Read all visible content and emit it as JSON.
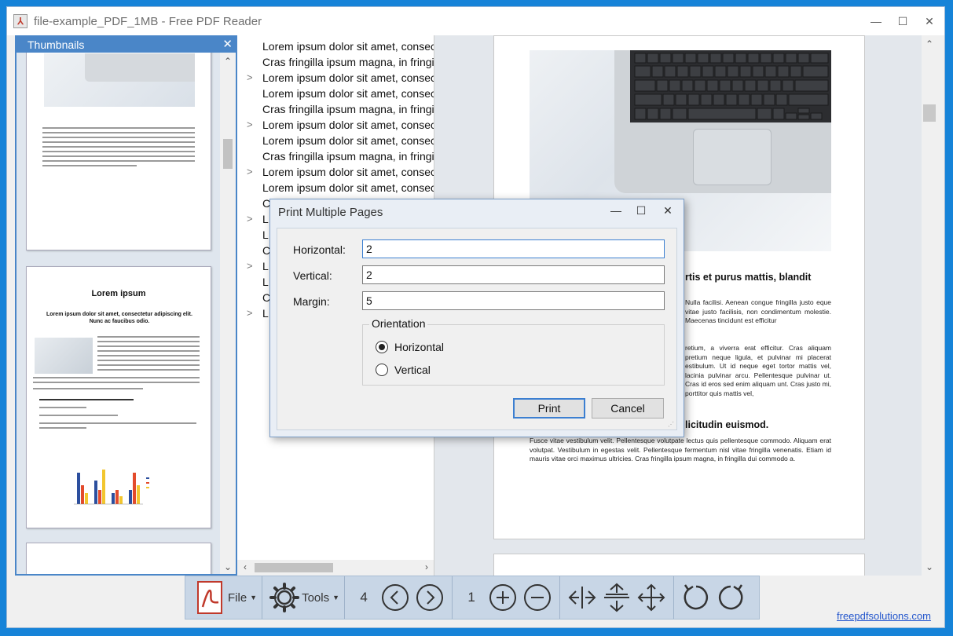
{
  "window": {
    "title": "file-example_PDF_1MB - Free PDF Reader",
    "minimize_glyph": "—",
    "maximize_glyph": "☐",
    "close_glyph": "✕"
  },
  "thumbnails": {
    "header": "Thumbnails",
    "close_glyph": "✕",
    "page2_title": "Lorem ipsum",
    "page2_subtitle": "Lorem ipsum dolor sit amet, consectetur adipiscing elit. Nunc ac faucibus odio."
  },
  "bookmarks": {
    "rows": [
      {
        "text": "Lorem ipsum dolor sit amet, consecte",
        "chevron": ""
      },
      {
        "text": "Cras fringilla ipsum magna, in fringilla",
        "chevron": ""
      },
      {
        "text": "Lorem ipsum dolor sit amet, consecte",
        "chevron": ">"
      },
      {
        "text": "Lorem ipsum dolor sit amet, consecte",
        "chevron": ""
      },
      {
        "text": "Cras fringilla ipsum magna, in fringilla",
        "chevron": ""
      },
      {
        "text": "Lorem ipsum dolor sit amet, consecte",
        "chevron": ">"
      },
      {
        "text": "Lorem ipsum dolor sit amet, consecte",
        "chevron": ""
      },
      {
        "text": "Cras fringilla ipsum magna, in fringilla",
        "chevron": ""
      },
      {
        "text": "Lorem ipsum dolor sit amet, consecte",
        "chevron": ">"
      },
      {
        "text": "Lorem ipsum dolor sit amet, consecte",
        "chevron": ""
      },
      {
        "text": "C",
        "chevron": ""
      },
      {
        "text": "L",
        "chevron": ">"
      },
      {
        "text": "L",
        "chevron": ""
      },
      {
        "text": "C",
        "chevron": ""
      },
      {
        "text": "L",
        "chevron": ">"
      },
      {
        "text": "L",
        "chevron": ""
      },
      {
        "text": "C",
        "chevron": ""
      },
      {
        "text": "L",
        "chevron": ">"
      }
    ]
  },
  "document": {
    "heading1": "rtis et purus mattis, blandit",
    "para1": "Nulla facilisi. Aenean congue fringilla justo eque vitae justo facilisis, non condimentum molestie. Maecenas tincidunt est efficitur",
    "para2": "retium, a viverra erat efficitur. Cras aliquam pretium neque ligula, et pulvinar mi placerat estibulum. Ut id neque eget tortor mattis vel, lacinia pulvinar arcu. Pellentesque pulvinar ut. Cras id eros sed enim aliquam unt. Cras justo mi, porttitor quis mattis vel,",
    "heading2": "licitudin euismod.",
    "para3": "Fusce vitae vestibulum velit. Pellentesque volutpate lectus quis pellentesque commodo. Aliquam erat volutpat. Vestibulum in egestas velit. Pellentesque fermentum nisl vitae fringilla venenatis. Etiam id mauris vitae orci maximus ultricies. Cras fringilla ipsum magna, in fringilla dui commodo a."
  },
  "dialog": {
    "title": "Print Multiple Pages",
    "horizontal_label": "Horizontal:",
    "horizontal_value": "2",
    "vertical_label": "Vertical:",
    "vertical_value": "2",
    "margin_label": "Margin:",
    "margin_value": "5",
    "orientation_title": "Orientation",
    "orientation_options": [
      "Horizontal",
      "Vertical"
    ],
    "orientation_selected": "Horizontal",
    "print_label": "Print",
    "cancel_label": "Cancel"
  },
  "toolbar": {
    "file_label": "File",
    "tools_label": "Tools",
    "page_count": "4",
    "current_page": "1"
  },
  "footer": {
    "link_text": "freepdfsolutions.com"
  },
  "colors": {
    "accent": "#4a86c8",
    "background": "#1683d8",
    "default_button_border": "#3c7fd1"
  }
}
